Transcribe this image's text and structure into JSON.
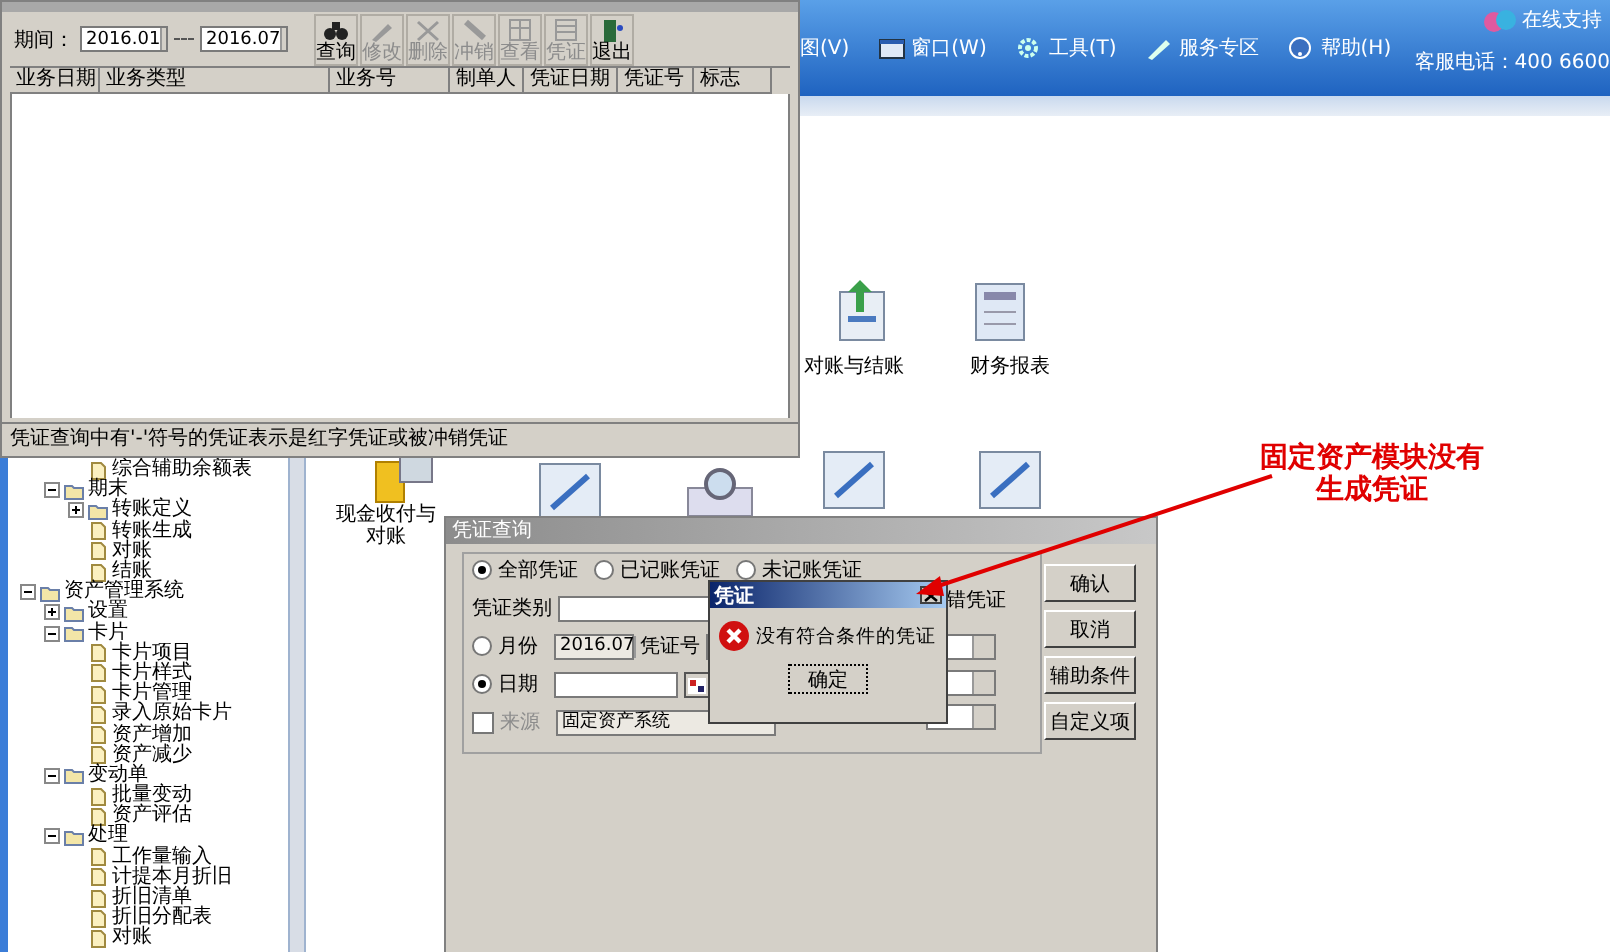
{
  "main_window": {
    "menu": [
      {
        "label": "图(V)",
        "kind": "view"
      },
      {
        "label": "窗口(W)",
        "kind": "window"
      },
      {
        "label": "工具(T)",
        "kind": "tools"
      },
      {
        "label": "服务专区",
        "kind": "service"
      },
      {
        "label": "帮助(H)",
        "kind": "help"
      }
    ],
    "support": "在线支持",
    "hotline": "客服电话：400 6600"
  },
  "sidebar": {
    "tree": [
      {
        "children": [
          {
            "children": [
              {
                "label": "综合辅助余额表",
                "kind": "file"
              }
            ]
          },
          {
            "label": "期末",
            "kind": "folder",
            "expanded": true,
            "children": [
              {
                "label": "转账定义",
                "kind": "folder",
                "expanded": false
              },
              {
                "label": "转账生成",
                "kind": "file"
              },
              {
                "label": "对账",
                "kind": "file"
              },
              {
                "label": "结账",
                "kind": "file"
              }
            ]
          }
        ]
      },
      {
        "label": "资产管理系统",
        "kind": "folder",
        "expanded": true,
        "children": [
          {
            "label": "设置",
            "kind": "folder",
            "expanded": false
          },
          {
            "label": "卡片",
            "kind": "folder",
            "expanded": true,
            "children": [
              {
                "label": "卡片项目",
                "kind": "file"
              },
              {
                "label": "卡片样式",
                "kind": "file"
              },
              {
                "label": "卡片管理",
                "kind": "file"
              },
              {
                "label": "录入原始卡片",
                "kind": "file"
              },
              {
                "label": "资产增加",
                "kind": "file"
              },
              {
                "label": "资产减少",
                "kind": "file"
              }
            ]
          },
          {
            "label": "变动单",
            "kind": "folder",
            "expanded": true,
            "children": [
              {
                "label": "批量变动",
                "kind": "file"
              },
              {
                "label": "资产评估",
                "kind": "file"
              }
            ]
          },
          {
            "label": "处理",
            "kind": "folder",
            "expanded": true,
            "children": [
              {
                "label": "工作量输入",
                "kind": "file"
              },
              {
                "label": "计提本月折旧",
                "kind": "file"
              },
              {
                "label": "折旧清单",
                "kind": "file"
              },
              {
                "label": "折旧分配表",
                "kind": "file"
              },
              {
                "label": "对账",
                "kind": "file"
              }
            ]
          }
        ]
      }
    ]
  },
  "desktop": {
    "items": [
      {
        "kind": "reconcile",
        "lines": [
          "对账与结账"
        ]
      },
      {
        "kind": "report",
        "lines": [
          "财务报表"
        ]
      },
      {
        "kind": "cash",
        "lines": [
          "现金收付与",
          "对账"
        ]
      }
    ]
  },
  "voucher_window": {
    "period_label": "期间：",
    "period_from": "2016.01",
    "period_to": "2016.07",
    "tools": [
      {
        "label": "查询",
        "kind": "search",
        "disabled": false
      },
      {
        "label": "修改",
        "kind": "edit",
        "disabled": true
      },
      {
        "label": "删除",
        "kind": "delete",
        "disabled": true
      },
      {
        "label": "冲销",
        "kind": "reverse",
        "disabled": true
      },
      {
        "label": "查看",
        "kind": "view",
        "disabled": true
      },
      {
        "label": "凭证",
        "kind": "voucher",
        "disabled": true
      },
      {
        "label": "退出",
        "kind": "exit",
        "disabled": false
      }
    ],
    "columns": [
      "业务日期",
      "业务类型",
      "业务号",
      "制单人",
      "凭证日期",
      "凭证号",
      "标志"
    ],
    "status": "凭证查询中有'-'符号的凭证表示是红字凭证或被冲销凭证"
  },
  "query_dialog": {
    "title": "凭证查询",
    "scope_options": [
      {
        "label": "全部凭证",
        "selected": true
      },
      {
        "label": "已记账凭证",
        "selected": false
      },
      {
        "label": "未记账凭证",
        "selected": false
      }
    ],
    "category_label": "凭证类别",
    "partial_label": "错凭证",
    "month": {
      "label": "月份",
      "selected": false,
      "value": "2016.07"
    },
    "voucher_no_label": "凭证号",
    "date": {
      "label": "日期",
      "selected": true
    },
    "source": {
      "label": "来源",
      "checked": false,
      "value": "固定资产系统"
    },
    "buttons": [
      "确认",
      "取消",
      "辅助条件",
      "自定义项"
    ]
  },
  "message_box": {
    "title": "凭证",
    "message": "没有符合条件的凭证",
    "button": "确定"
  },
  "annotation": {
    "lines": [
      "固定资产模块没有",
      "生成凭证"
    ]
  }
}
